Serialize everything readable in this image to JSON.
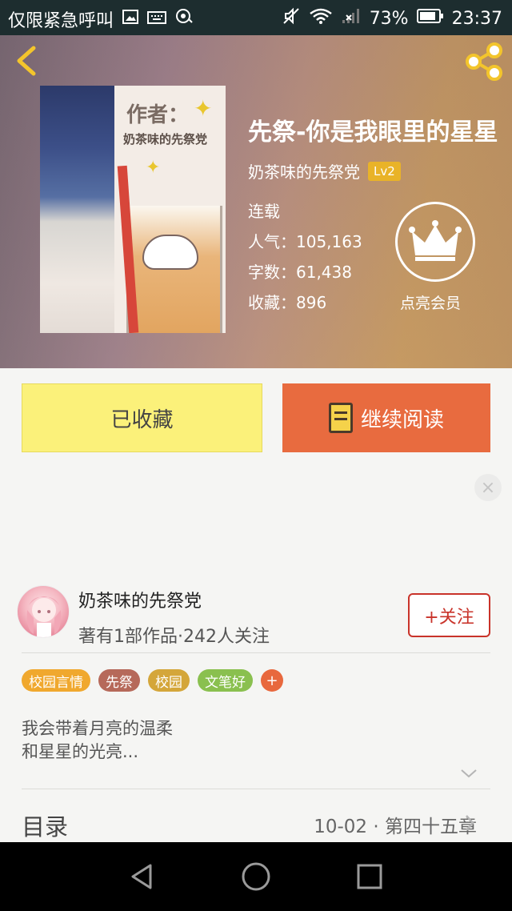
{
  "status_bar": {
    "carrier_text": "仅限紧急呼叫",
    "battery": "73%",
    "time": "23:37"
  },
  "header": {
    "icons": [
      "back-arrow-icon",
      "share-icon"
    ]
  },
  "cover": {
    "author_label": "作者：",
    "author_name": "奶茶味的先祭党"
  },
  "book": {
    "title": "先祭-你是我眼里的星星",
    "author": "奶茶味的先祭党",
    "level": "Lv2",
    "status": "连载",
    "popularity": "人气：105,163",
    "word_count": "字数：61,438",
    "favorites": "收藏：896",
    "vip_label": "点亮会员"
  },
  "actions": {
    "collected_label": "已收藏",
    "continue_label": "继续阅读"
  },
  "author_card": {
    "name": "奶茶味的先祭党",
    "meta": "著有1部作品·242人关注",
    "follow_label": "+关注"
  },
  "tags": [
    {
      "label": "校园言情",
      "color": "#f0a82e"
    },
    {
      "label": "先祭",
      "color": "#b6695a"
    },
    {
      "label": "校园",
      "color": "#d4a63a"
    },
    {
      "label": "文笔好",
      "color": "#8ac04f"
    }
  ],
  "tag_add_label": "+",
  "intro": {
    "line1": "我会带着月亮的温柔",
    "line2": "和星星的光亮..."
  },
  "toc": {
    "label": "目录",
    "latest": "10-02 · 第四十五章"
  },
  "colors": {
    "accent_orange": "#e86b3f",
    "collected_yellow": "#fbf17a",
    "follow_red": "#c9332a",
    "level_badge": "#e9b328"
  }
}
